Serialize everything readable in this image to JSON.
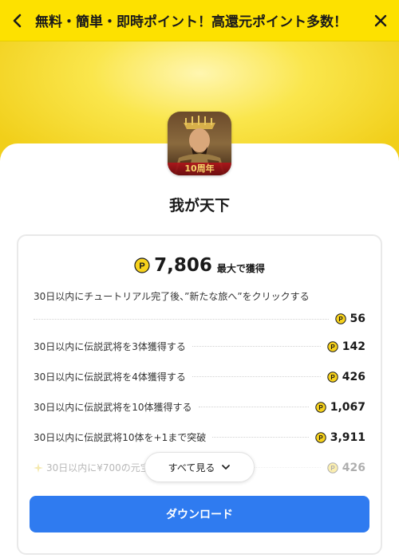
{
  "header": {
    "title": "無料・簡単・即時ポイント！高還元ポイント多数！"
  },
  "app": {
    "name": "我が天下",
    "icon_badge": "10周年"
  },
  "points": {
    "total": "7,806",
    "suffix": "最大で獲得",
    "coin_letter": "P"
  },
  "tasks": [
    {
      "label": "30日以内にチュートリアル完了後、”新たな旅へ”をクリックする",
      "points": "56"
    },
    {
      "label": "30日以内に伝説武将を3体獲得する",
      "points": "142"
    },
    {
      "label": "30日以内に伝説武将を4体獲得する",
      "points": "426"
    },
    {
      "label": "30日以内に伝説武将を10体獲得する",
      "points": "1,067"
    },
    {
      "label": "30日以内に伝説武将10体を+1まで突破",
      "points": "3,911"
    },
    {
      "label": "30日以内に¥700の元宝",
      "points": "426"
    }
  ],
  "buttons": {
    "see_all": "すべて見る",
    "download": "ダウンロード"
  },
  "colors": {
    "header_bg": "#fde100",
    "coin": "#f7d21c",
    "download_bg": "#2f7bf0"
  }
}
